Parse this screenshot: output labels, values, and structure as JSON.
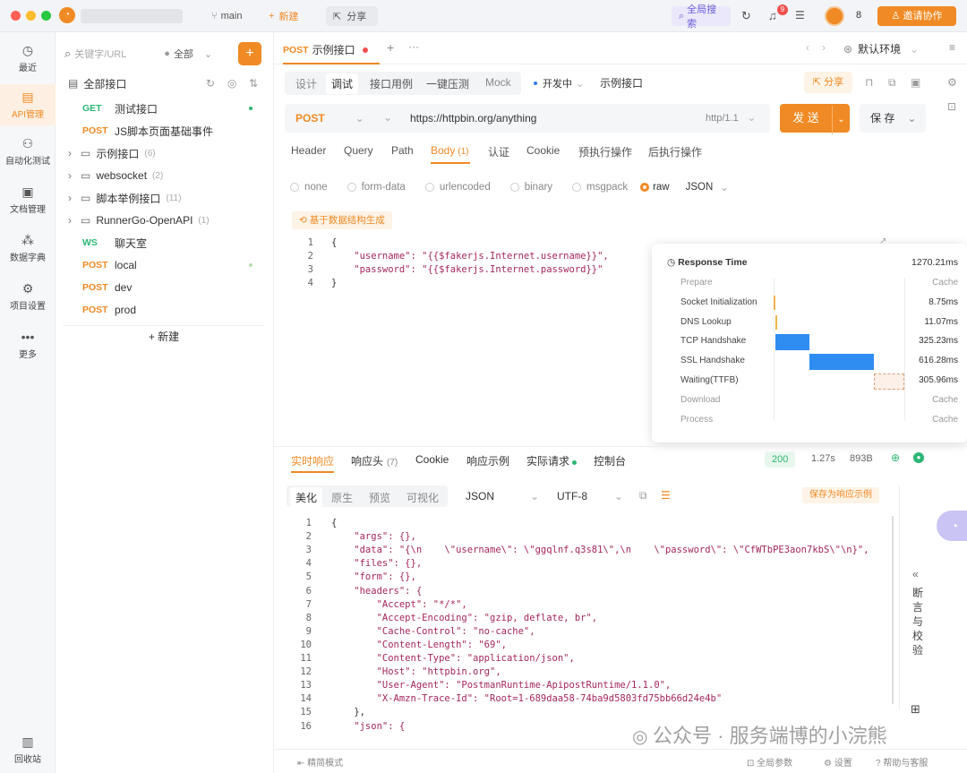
{
  "titlebar": {
    "branch": "main",
    "new_label": "新建",
    "share_label": "分享",
    "global_search": "全局搜索",
    "notif_count": "9",
    "user_count": "8",
    "invite_label": "邀请协作"
  },
  "nav": [
    {
      "label": "最近",
      "icon": "clock-icon"
    },
    {
      "label": "API管理",
      "icon": "api-icon"
    },
    {
      "label": "自动化测试",
      "icon": "automation-icon"
    },
    {
      "label": "文档管理",
      "icon": "document-icon"
    },
    {
      "label": "数据字典",
      "icon": "dictionary-icon"
    },
    {
      "label": "项目设置",
      "icon": "settings-icon"
    },
    {
      "label": "更多",
      "icon": "more-icon"
    },
    {
      "label": "回收站",
      "icon": "trash-icon"
    }
  ],
  "sidebar": {
    "search_placeholder": "关键字/URL",
    "filter": "全部",
    "root": "全部接口",
    "items": [
      {
        "method": "GET",
        "name": "测试接口",
        "count": ""
      },
      {
        "method": "POST",
        "name": "JS脚本页面基础事件",
        "count": ""
      },
      {
        "method": "",
        "name": "示例接口",
        "count": "(6)"
      },
      {
        "method": "",
        "name": "websocket",
        "count": "(2)"
      },
      {
        "method": "",
        "name": "脚本举例接口",
        "count": "(11)"
      },
      {
        "method": "",
        "name": "RunnerGo-OpenAPI",
        "count": "(1)"
      },
      {
        "method": "WS",
        "name": "聊天室",
        "count": ""
      },
      {
        "method": "POST",
        "name": "local",
        "count": ""
      },
      {
        "method": "POST",
        "name": "dev",
        "count": ""
      },
      {
        "method": "POST",
        "name": "prod",
        "count": ""
      }
    ],
    "new_label": "+ 新建"
  },
  "tab": {
    "method": "POST",
    "name": "示例接口",
    "env": "默认环境"
  },
  "subtabs": [
    "设计",
    "调试",
    "接口用例",
    "一键压测",
    "Mock"
  ],
  "status_dev": "开发中",
  "api_name": "示例接口",
  "share_btn": "分享",
  "request": {
    "method": "POST",
    "url": "https://httpbin.org/anything",
    "protocol": "http/1.1",
    "send": "发 送",
    "save": "保 存"
  },
  "req_tabs": [
    "Header",
    "Query",
    "Path",
    "Body",
    "认证",
    "Cookie",
    "预执行操作",
    "后执行操作"
  ],
  "body_count": "(1)",
  "body_types": [
    "none",
    "form-data",
    "urlencoded",
    "binary",
    "msgpack",
    "raw",
    "JSON"
  ],
  "gen_btn": "基于数据结构生成",
  "req_code": [
    "{",
    "    \"username\": \"{{$fakerjs.Internet.username}}\",",
    "    \"password\": \"{{$fakerjs.Internet.password}}\"",
    "}"
  ],
  "timing": {
    "title": "Response Time",
    "total": "1270.21ms",
    "rows": [
      {
        "label": "Prepare",
        "value": "Cache"
      },
      {
        "label": "Socket Initialization",
        "value": "8.75ms"
      },
      {
        "label": "DNS Lookup",
        "value": "11.07ms"
      },
      {
        "label": "TCP Handshake",
        "value": "325.23ms"
      },
      {
        "label": "SSL Handshake",
        "value": "616.28ms"
      },
      {
        "label": "Waiting(TTFB)",
        "value": "305.96ms"
      },
      {
        "label": "Download",
        "value": "Cache"
      },
      {
        "label": "Process",
        "value": "Cache"
      }
    ]
  },
  "resp_tabs": [
    "实时响应",
    "响应头",
    "Cookie",
    "响应示例",
    "实际请求",
    "控制台"
  ],
  "resp_header_count": "(7)",
  "resp_status": {
    "code": "200",
    "time": "1.27s",
    "size": "893B"
  },
  "view_tabs": [
    "美化",
    "原生",
    "预览",
    "可视化"
  ],
  "format": "JSON",
  "encoding": "UTF-8",
  "save_example": "保存为响应示例",
  "assert_label": "断言与校验",
  "resp_code": [
    "{",
    "    \"args\": {},",
    "    \"data\": \"{\\n    \\\"username\\\": \\\"ggqlnf.q3s81\\\",\\n    \\\"password\\\": \\\"CfWTbPE3aon7kbS\\\"\\n}\",",
    "    \"files\": {},",
    "    \"form\": {},",
    "    \"headers\": {",
    "        \"Accept\": \"*/*\",",
    "        \"Accept-Encoding\": \"gzip, deflate, br\",",
    "        \"Cache-Control\": \"no-cache\",",
    "        \"Content-Length\": \"69\",",
    "        \"Content-Type\": \"application/json\",",
    "        \"Host\": \"httpbin.org\",",
    "        \"User-Agent\": \"PostmanRuntime-ApipostRuntime/1.1.0\",",
    "        \"X-Amzn-Trace-Id\": \"Root=1-689daa58-74ba9d5803fd75bb66d24e4b\"",
    "    },",
    "    \"json\": {"
  ],
  "footer": {
    "left": "精简模式",
    "search": "全局参数",
    "settings": "设置",
    "help": "帮助与客服"
  },
  "watermark": "公众号 · 服务端博的小浣熊"
}
